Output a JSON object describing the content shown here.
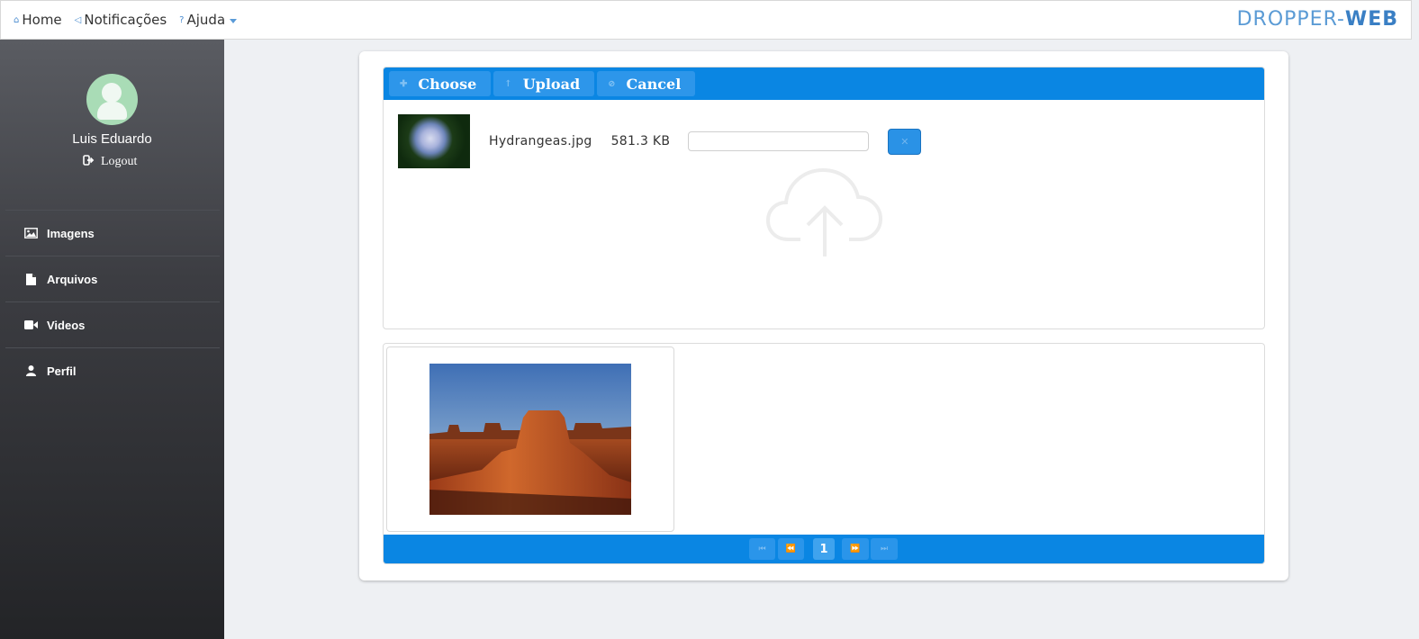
{
  "nav": {
    "home_label": "Home",
    "notifications_label": "Notificações",
    "help_label": "Ajuda",
    "brand_part1": "DROPPER-",
    "brand_part2": "WEB"
  },
  "sidebar": {
    "user_name": "Luis Eduardo",
    "logout_label": "Logout",
    "items": [
      {
        "label": "Imagens",
        "icon": "image-icon"
      },
      {
        "label": "Arquivos",
        "icon": "file-icon"
      },
      {
        "label": "Videos",
        "icon": "video-icon"
      },
      {
        "label": "Perfil",
        "icon": "user-icon"
      }
    ]
  },
  "uploader": {
    "choose_label": "Choose",
    "upload_label": "Upload",
    "cancel_label": "Cancel",
    "file": {
      "name": "Hydrangeas.jpg",
      "size": "581.3 KB",
      "progress": 0
    },
    "drop_icon": "cloud-upload-icon"
  },
  "gallery": {
    "items": [
      {
        "image": "desert-landscape"
      }
    ]
  },
  "paginator": {
    "first_icon": "first-page-icon",
    "prev_icon": "prev-page-icon",
    "current_page": "1",
    "next_icon": "next-page-icon",
    "last_icon": "last-page-icon"
  },
  "colors": {
    "accent": "#0a86e3",
    "brand": "#3a7fc4",
    "avatar": "#a9dcb6"
  }
}
